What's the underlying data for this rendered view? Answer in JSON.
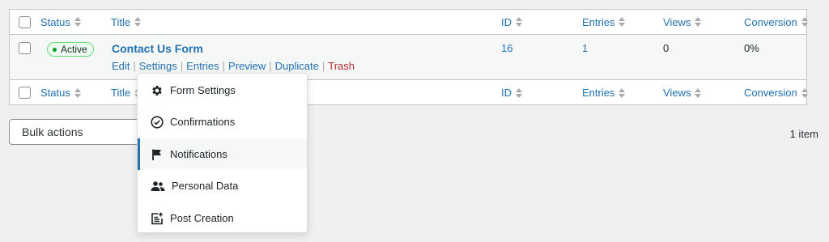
{
  "columns": {
    "status": "Status",
    "title": "Title",
    "id": "ID",
    "entries": "Entries",
    "views": "Views",
    "conversion": "Conversion"
  },
  "row": {
    "status_badge": "Active",
    "title": "Contact Us Form",
    "id": "16",
    "entries": "1",
    "views": "0",
    "conversion": "0%",
    "actions": {
      "edit": "Edit",
      "settings": "Settings",
      "entries": "Entries",
      "preview": "Preview",
      "duplicate": "Duplicate",
      "trash": "Trash"
    }
  },
  "bulk_actions": {
    "label": "Bulk actions"
  },
  "item_count": "1 item",
  "settings_menu": {
    "items": [
      {
        "label": "Form Settings",
        "icon": "gear-icon"
      },
      {
        "label": "Confirmations",
        "icon": "check-circle-icon"
      },
      {
        "label": "Notifications",
        "icon": "flag-icon"
      },
      {
        "label": "Personal Data",
        "icon": "users-icon"
      },
      {
        "label": "Post Creation",
        "icon": "post-add-icon"
      }
    ],
    "active_index": 2
  },
  "colors": {
    "link": "#2271b1",
    "trash": "#b32d2e",
    "active_dot": "#00a32a",
    "border": "#c3c4c7",
    "background": "#f0f0f1"
  }
}
